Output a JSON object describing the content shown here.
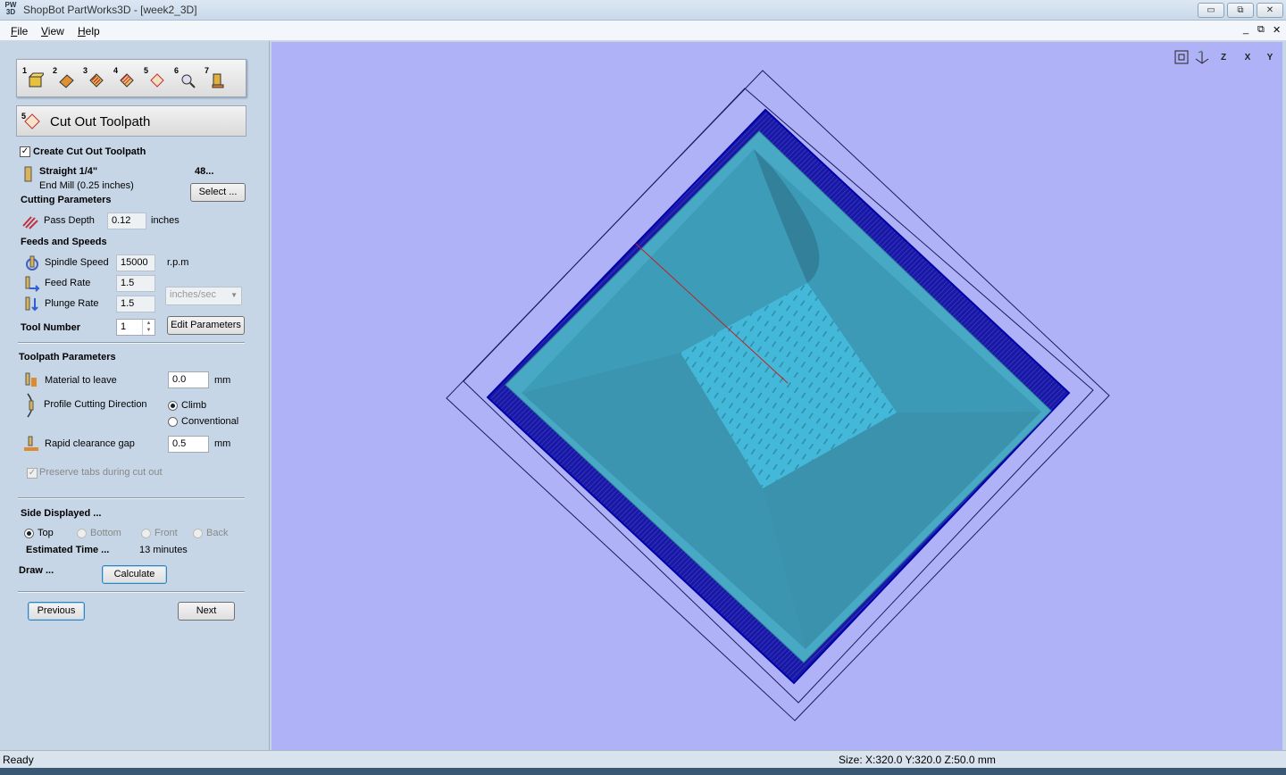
{
  "window": {
    "app_icon": "PW 3D",
    "title": "ShopBot PartWorks3D - [week2_3D]",
    "minimize": "▭",
    "restore": "⧉",
    "close": "✕"
  },
  "menu": {
    "file_u": "F",
    "file_rest": "ile",
    "view_u": "V",
    "view_rest": "iew",
    "help_u": "H",
    "help_rest": "elp",
    "mdi_min": "_",
    "mdi_restore": "⧉",
    "mdi_close": "✕"
  },
  "steps": [
    {
      "num": "1",
      "icon": "import-model-icon"
    },
    {
      "num": "2",
      "icon": "orientation-icon"
    },
    {
      "num": "3",
      "icon": "roughing-toolpath-icon"
    },
    {
      "num": "4",
      "icon": "finish-toolpath-icon"
    },
    {
      "num": "5",
      "icon": "cut-out-toolpath-icon"
    },
    {
      "num": "6",
      "icon": "preview-icon"
    },
    {
      "num": "7",
      "icon": "save-toolpath-icon"
    }
  ],
  "header": {
    "num": "5",
    "title": "Cut Out Toolpath"
  },
  "create": {
    "checked": "✓",
    "label": "Create Cut Out Toolpath"
  },
  "tool": {
    "name": "Straight 1/4\"",
    "number": "48...",
    "desc": "End Mill (0.25 inches)",
    "select_label": "Select ..."
  },
  "cutting": {
    "heading": "Cutting Parameters",
    "pass_depth_label": "Pass Depth",
    "pass_depth_value": "0.12",
    "pass_depth_unit": "inches"
  },
  "feeds": {
    "heading": "Feeds and Speeds",
    "spindle_label": "Spindle Speed",
    "spindle_value": "15000",
    "spindle_unit": "r.p.m",
    "feed_label": "Feed Rate",
    "feed_value": "1.5",
    "plunge_label": "Plunge Rate",
    "plunge_value": "1.5",
    "rate_unit": "inches/sec",
    "tool_number_label": "Tool Number",
    "tool_number_value": "1",
    "edit_label": "Edit Parameters"
  },
  "toolpath": {
    "heading": "Toolpath Parameters",
    "material_label": "Material to leave",
    "material_value": "0.0",
    "material_unit": "mm",
    "direction_label": "Profile Cutting Direction",
    "climb_label": "Climb",
    "conventional_label": "Conventional",
    "rapid_label": "Rapid clearance gap",
    "rapid_value": "0.5",
    "rapid_unit": "mm",
    "tabs_label": "Preserve tabs during cut out",
    "tabs_checked": "✓"
  },
  "side": {
    "heading": "Side Displayed ...",
    "top": "Top",
    "bottom": "Bottom",
    "front": "Front",
    "back": "Back",
    "est_label": "Estimated Time ...",
    "est_value": "13 minutes",
    "draw_label": "Draw ...",
    "calculate_label": "Calculate"
  },
  "nav": {
    "previous": "Previous",
    "next": "Next"
  },
  "view_tools": [
    "zoom-extents-icon",
    "iso-view-icon",
    "z-view-icon",
    "x-view-icon",
    "y-view-icon"
  ],
  "view_tool_labels": [
    "",
    "",
    "Z",
    "X",
    "Y"
  ],
  "status": {
    "left": "Ready",
    "right": "Size: X:320.0 Y:320.0 Z:50.0 mm"
  },
  "colors": {
    "viewport": "#b0b2f8",
    "model": "#3fa3bf",
    "boundary": "#1a1aa8"
  }
}
